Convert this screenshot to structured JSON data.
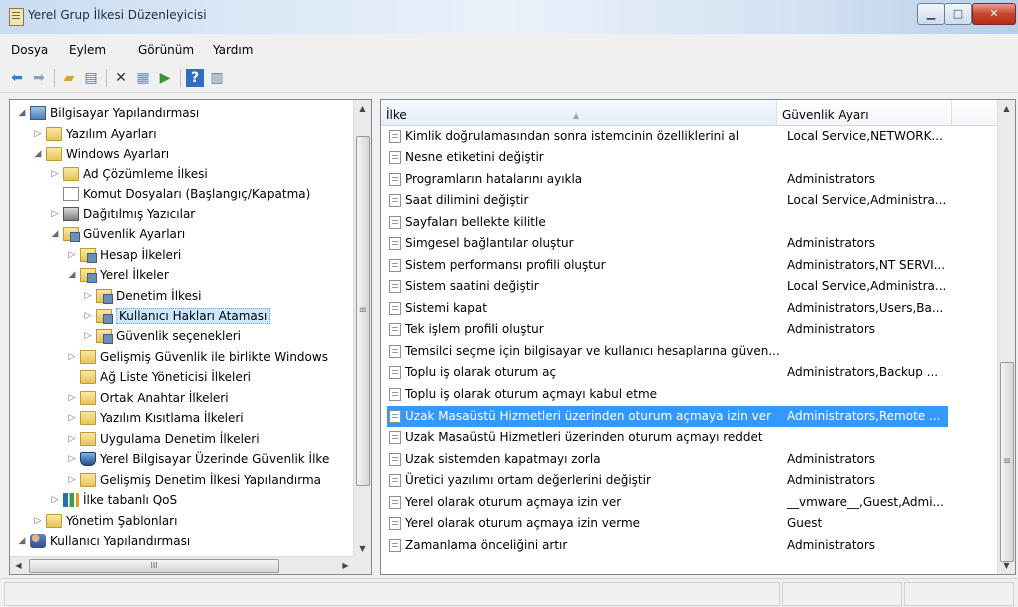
{
  "window": {
    "title": "Yerel Grup İlkesi Düzenleyicisi",
    "controls": {
      "minimize": "▁",
      "maximize": "□",
      "close": "✕"
    }
  },
  "menu": [
    "Dosya",
    "Eylem",
    "Görünüm",
    "Yardım"
  ],
  "toolbar": [
    "back-arrow-icon",
    "forward-arrow-icon",
    "up-folder-icon",
    "show-hide-tree-icon",
    "delete-icon",
    "properties-icon",
    "export-list-icon",
    "help-icon",
    "extended-view-icon"
  ],
  "tree": {
    "items": [
      {
        "label": "Bilgisayar Yapılandırması",
        "icon": "computer-icon",
        "toggle": "◢"
      },
      {
        "label": "Yazılım Ayarları",
        "icon": "folder-icon",
        "toggle": "▷"
      },
      {
        "label": "Windows Ayarları",
        "icon": "folder-icon",
        "toggle": "◢"
      },
      {
        "label": "Ad Çözümleme İlkesi",
        "icon": "folder-icon",
        "toggle": "▷"
      },
      {
        "label": "Komut Dosyaları (Başlangıç/Kapatma)",
        "icon": "script-icon",
        "toggle": ""
      },
      {
        "label": "Dağıtılmış Yazıcılar",
        "icon": "printer-icon",
        "toggle": "▷"
      },
      {
        "label": "Güvenlik Ayarları",
        "icon": "security-settings-icon",
        "toggle": "◢"
      },
      {
        "label": "Hesap İlkeleri",
        "icon": "security-folder-icon",
        "toggle": "▷"
      },
      {
        "label": "Yerel İlkeler",
        "icon": "security-folder-icon",
        "toggle": "◢"
      },
      {
        "label": "Denetim İlkesi",
        "icon": "security-folder-icon",
        "toggle": "▷"
      },
      {
        "label": "Kullanıcı Hakları Ataması",
        "icon": "security-folder-icon",
        "toggle": "▷"
      },
      {
        "label": "Güvenlik seçenekleri",
        "icon": "security-folder-icon",
        "toggle": "▷"
      },
      {
        "label": "Gelişmiş Güvenlik ile birlikte Windows",
        "icon": "folder-icon",
        "toggle": "▷"
      },
      {
        "label": "Ağ Liste Yöneticisi İlkeleri",
        "icon": "folder-icon",
        "toggle": ""
      },
      {
        "label": "Ortak Anahtar İlkeleri",
        "icon": "folder-icon",
        "toggle": "▷"
      },
      {
        "label": "Yazılım Kısıtlama İlkeleri",
        "icon": "folder-icon",
        "toggle": "▷"
      },
      {
        "label": "Uygulama Denetim İlkeleri",
        "icon": "folder-icon",
        "toggle": "▷"
      },
      {
        "label": "Yerel Bilgisayar Üzerinde Güvenlik İlke",
        "icon": "firewall-icon",
        "toggle": "▷"
      },
      {
        "label": "Gelişmiş Denetim İlkesi Yapılandırma",
        "icon": "folder-icon",
        "toggle": "▷"
      },
      {
        "label": "İlke tabanlı QoS",
        "icon": "qos-chart-icon",
        "toggle": "▷"
      },
      {
        "label": "Yönetim Şablonları",
        "icon": "folder-icon",
        "toggle": "▷"
      },
      {
        "label": "Kullanıcı Yapılandırması",
        "icon": "users-icon",
        "toggle": "◢"
      }
    ],
    "scroll_thumb_glyph": "≡",
    "hscroll_thumb_glyph": "III",
    "arrows": {
      "up": "▲",
      "down": "▼",
      "left": "◀",
      "right": "▶"
    }
  },
  "list": {
    "columns": {
      "name": "İlke",
      "setting": "Güvenlik Ayarı"
    },
    "sort_indicator": "▲",
    "rows": [
      {
        "name": "Kimlik doğrulamasından sonra istemcinin özelliklerini al",
        "setting": "Local Service,NETWORK..."
      },
      {
        "name": "Nesne etiketini değiştir",
        "setting": ""
      },
      {
        "name": "Programların hatalarını ayıkla",
        "setting": "Administrators"
      },
      {
        "name": "Saat dilimini değiştir",
        "setting": "Local Service,Administra..."
      },
      {
        "name": "Sayfaları bellekte kilitle",
        "setting": ""
      },
      {
        "name": "Simgesel bağlantılar oluştur",
        "setting": "Administrators"
      },
      {
        "name": "Sistem performansı profili oluştur",
        "setting": "Administrators,NT SERVI..."
      },
      {
        "name": "Sistem saatini değiştir",
        "setting": "Local Service,Administra..."
      },
      {
        "name": "Sistemi kapat",
        "setting": "Administrators,Users,Ba..."
      },
      {
        "name": "Tek işlem profili oluştur",
        "setting": "Administrators"
      },
      {
        "name": "Temsilci seçme için bilgisayar ve kullanıcı hesaplarına güven...",
        "setting": ""
      },
      {
        "name": "Toplu iş olarak oturum aç",
        "setting": "Administrators,Backup ..."
      },
      {
        "name": "Toplu iş olarak oturum açmayı kabul etme",
        "setting": ""
      },
      {
        "name": "Uzak Masaüstü Hizmetleri üzerinden oturum açmaya izin ver",
        "setting": "Administrators,Remote ..."
      },
      {
        "name": "Uzak Masaüstü Hizmetleri üzerinden oturum açmayı reddet",
        "setting": ""
      },
      {
        "name": "Uzak sistemden kapatmayı zorla",
        "setting": "Administrators"
      },
      {
        "name": "Üretici yazılımı ortam değerlerini değiştir",
        "setting": "Administrators"
      },
      {
        "name": "Yerel olarak oturum açmaya izin ver",
        "setting": "__vmware__,Guest,Admi..."
      },
      {
        "name": "Yerel olarak oturum açmaya izin verme",
        "setting": "Guest"
      },
      {
        "name": "Zamanlama önceliğini artır",
        "setting": "Administrators"
      }
    ]
  },
  "colors": {
    "selection": "#3399ff",
    "tree_selection": "#cce8ff"
  }
}
